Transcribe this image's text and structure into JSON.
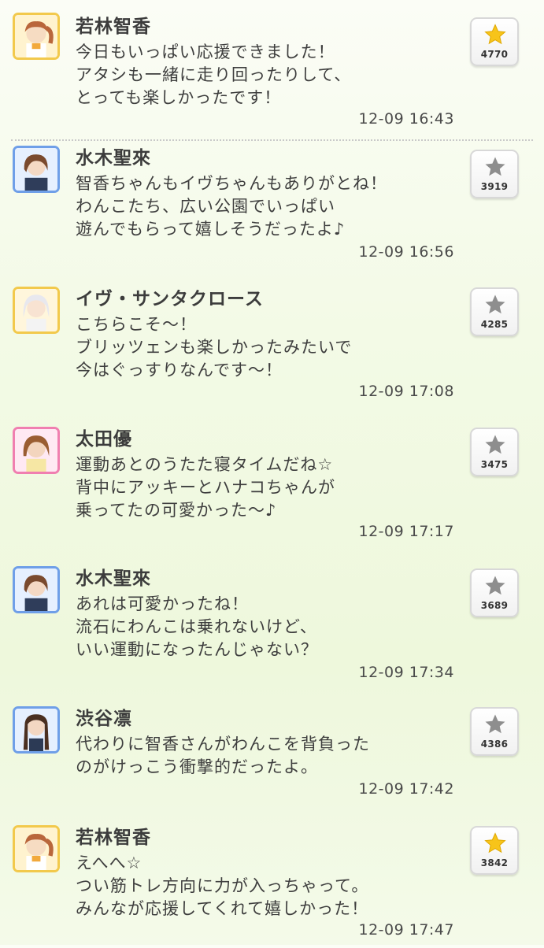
{
  "colors": {
    "star_active": "#f7c41a",
    "star_inactive": "#8e8e8e"
  },
  "posts": [
    {
      "name": "若林智香",
      "lines": [
        "今日もいっぱい応援できました！",
        "アタシも一緒に走り回ったりして、",
        "とっても楽しかったです！"
      ],
      "time": "12-09 16:43",
      "likes": "4770",
      "liked": true,
      "avatar_frame": "gold"
    },
    {
      "name": "水木聖來",
      "lines": [
        "智香ちゃんもイヴちゃんもありがとね！",
        "わんこたち、広い公園でいっぱい",
        "遊んでもらって嬉しそうだったよ♪"
      ],
      "time": "12-09 16:56",
      "likes": "3919",
      "liked": false,
      "avatar_frame": "blue"
    },
    {
      "name": "イヴ・サンタクロース",
      "lines": [
        "こちらこそ〜！",
        "ブリッツェンも楽しかったみたいで",
        "今はぐっすりなんです〜！"
      ],
      "time": "12-09 17:08",
      "likes": "4285",
      "liked": false,
      "avatar_frame": "gold"
    },
    {
      "name": "太田優",
      "lines": [
        "運動あとのうたた寝タイムだね☆",
        "背中にアッキーとハナコちゃんが",
        "乗ってたの可愛かった〜♪"
      ],
      "time": "12-09 17:17",
      "likes": "3475",
      "liked": false,
      "avatar_frame": "pink"
    },
    {
      "name": "水木聖來",
      "lines": [
        "あれは可愛かったね！",
        "流石にわんこは乗れないけど、",
        "いい運動になったんじゃない？"
      ],
      "time": "12-09 17:34",
      "likes": "3689",
      "liked": false,
      "avatar_frame": "blue"
    },
    {
      "name": "渋谷凛",
      "lines": [
        "代わりに智香さんがわんこを背負った",
        "のがけっこう衝撃的だったよ。"
      ],
      "time": "12-09 17:42",
      "likes": "4386",
      "liked": false,
      "avatar_frame": "blue"
    },
    {
      "name": "若林智香",
      "lines": [
        "えへへ☆",
        "つい筋トレ方向に力が入っちゃって。",
        "みんなが応援してくれて嬉しかった！"
      ],
      "time": "12-09 17:47",
      "likes": "3842",
      "liked": true,
      "avatar_frame": "gold"
    }
  ]
}
